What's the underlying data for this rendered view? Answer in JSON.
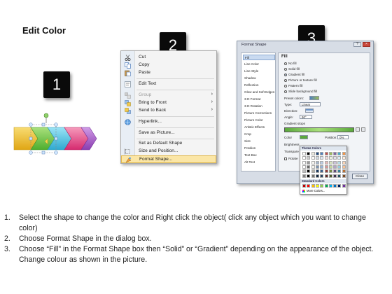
{
  "page": {
    "title": "Edit Color",
    "badges": [
      "1",
      "2",
      "3"
    ]
  },
  "context_menu": {
    "items": [
      {
        "label": "Cut",
        "icon": "scissors-icon",
        "disabled": false,
        "submenu": false
      },
      {
        "label": "Copy",
        "icon": "copy-icon",
        "disabled": false,
        "submenu": false
      },
      {
        "label": "Paste",
        "icon": "paste-icon",
        "disabled": false,
        "submenu": false
      },
      {
        "label": "Edit Text",
        "icon": "edit-text-icon",
        "disabled": false,
        "submenu": false
      },
      {
        "label": "Group",
        "icon": "group-icon",
        "disabled": true,
        "submenu": true
      },
      {
        "label": "Bring to Front",
        "icon": "bring-front-icon",
        "disabled": false,
        "submenu": true
      },
      {
        "label": "Send to Back",
        "icon": "send-back-icon",
        "disabled": false,
        "submenu": true
      },
      {
        "label": "Hyperlink...",
        "icon": "hyperlink-icon",
        "disabled": false,
        "submenu": false
      },
      {
        "label": "Save as Picture...",
        "icon": "",
        "disabled": false,
        "submenu": false
      },
      {
        "label": "Set as Default Shape",
        "icon": "",
        "disabled": false,
        "submenu": false
      },
      {
        "label": "Size and Position...",
        "icon": "size-icon",
        "disabled": false,
        "submenu": false
      },
      {
        "label": "Format Shape...",
        "icon": "format-shape-icon",
        "disabled": false,
        "submenu": false,
        "selected": true
      }
    ]
  },
  "dialog": {
    "title": "Format Shape",
    "categories": [
      "Fill",
      "Line Color",
      "Line Style",
      "Shadow",
      "Reflection",
      "Glow and Soft Edges",
      "3-D Format",
      "3-D Rotation",
      "Picture Corrections",
      "Picture Color",
      "Artistic Effects",
      "Crop",
      "Size",
      "Position",
      "Text Box",
      "Alt Text"
    ],
    "fill_heading": "Fill",
    "fill_options": [
      "No fill",
      "Solid fill",
      "Gradient fill",
      "Picture or texture fill",
      "Pattern fill",
      "Slide background fill"
    ],
    "selected_fill": "Gradient fill",
    "preset_colors_label": "Preset colors:",
    "type_label": "Type:",
    "type_value": "Linear",
    "direction_label": "Direction:",
    "angle_label": "Angle:",
    "angle_value": "90°",
    "gradient_stops_label": "Gradient stops",
    "color_label": "Color",
    "position_label": "Position:",
    "position_value": "0%",
    "brightness_label": "Brightness",
    "transparency_label": "Transpare",
    "rotate_label": "Rotate",
    "close_label": "Close"
  },
  "palette": {
    "theme_label": "Theme Colors",
    "standard_label": "Standard Colors",
    "more_label": "More Colors...",
    "theme_top": [
      "#ffffff",
      "#000000",
      "#eeece1",
      "#1f497d",
      "#4f81bd",
      "#c0504d",
      "#9bbb59",
      "#8064a2",
      "#4bacc6",
      "#f79646"
    ],
    "standard": [
      "#c00000",
      "#ff0000",
      "#ffc000",
      "#ffff00",
      "#92d050",
      "#00b050",
      "#00b0f0",
      "#0070c0",
      "#002060",
      "#7030a0"
    ]
  },
  "steps": [
    {
      "num": "1.",
      "text": "Select the shape to change the color and Right click the object( click any object which you want to change color)"
    },
    {
      "num": "2.",
      "text": "Choose Format Shape in the dialog box."
    },
    {
      "num": "3.",
      "text": "Choose “Fill” in the Format Shape box then “Solid” or “Gradient” depending on the appearance of the object. Change colour as shown in the picture."
    }
  ],
  "colors": {
    "arrow_yellow": "#f2c230",
    "arrow_green": "#7ccf52",
    "arrow_cyan": "#53c8e6",
    "arrow_pink": "#e8408a",
    "arrow_purple": "#a45bc8",
    "menu_highlight": "#fbe6a6"
  }
}
